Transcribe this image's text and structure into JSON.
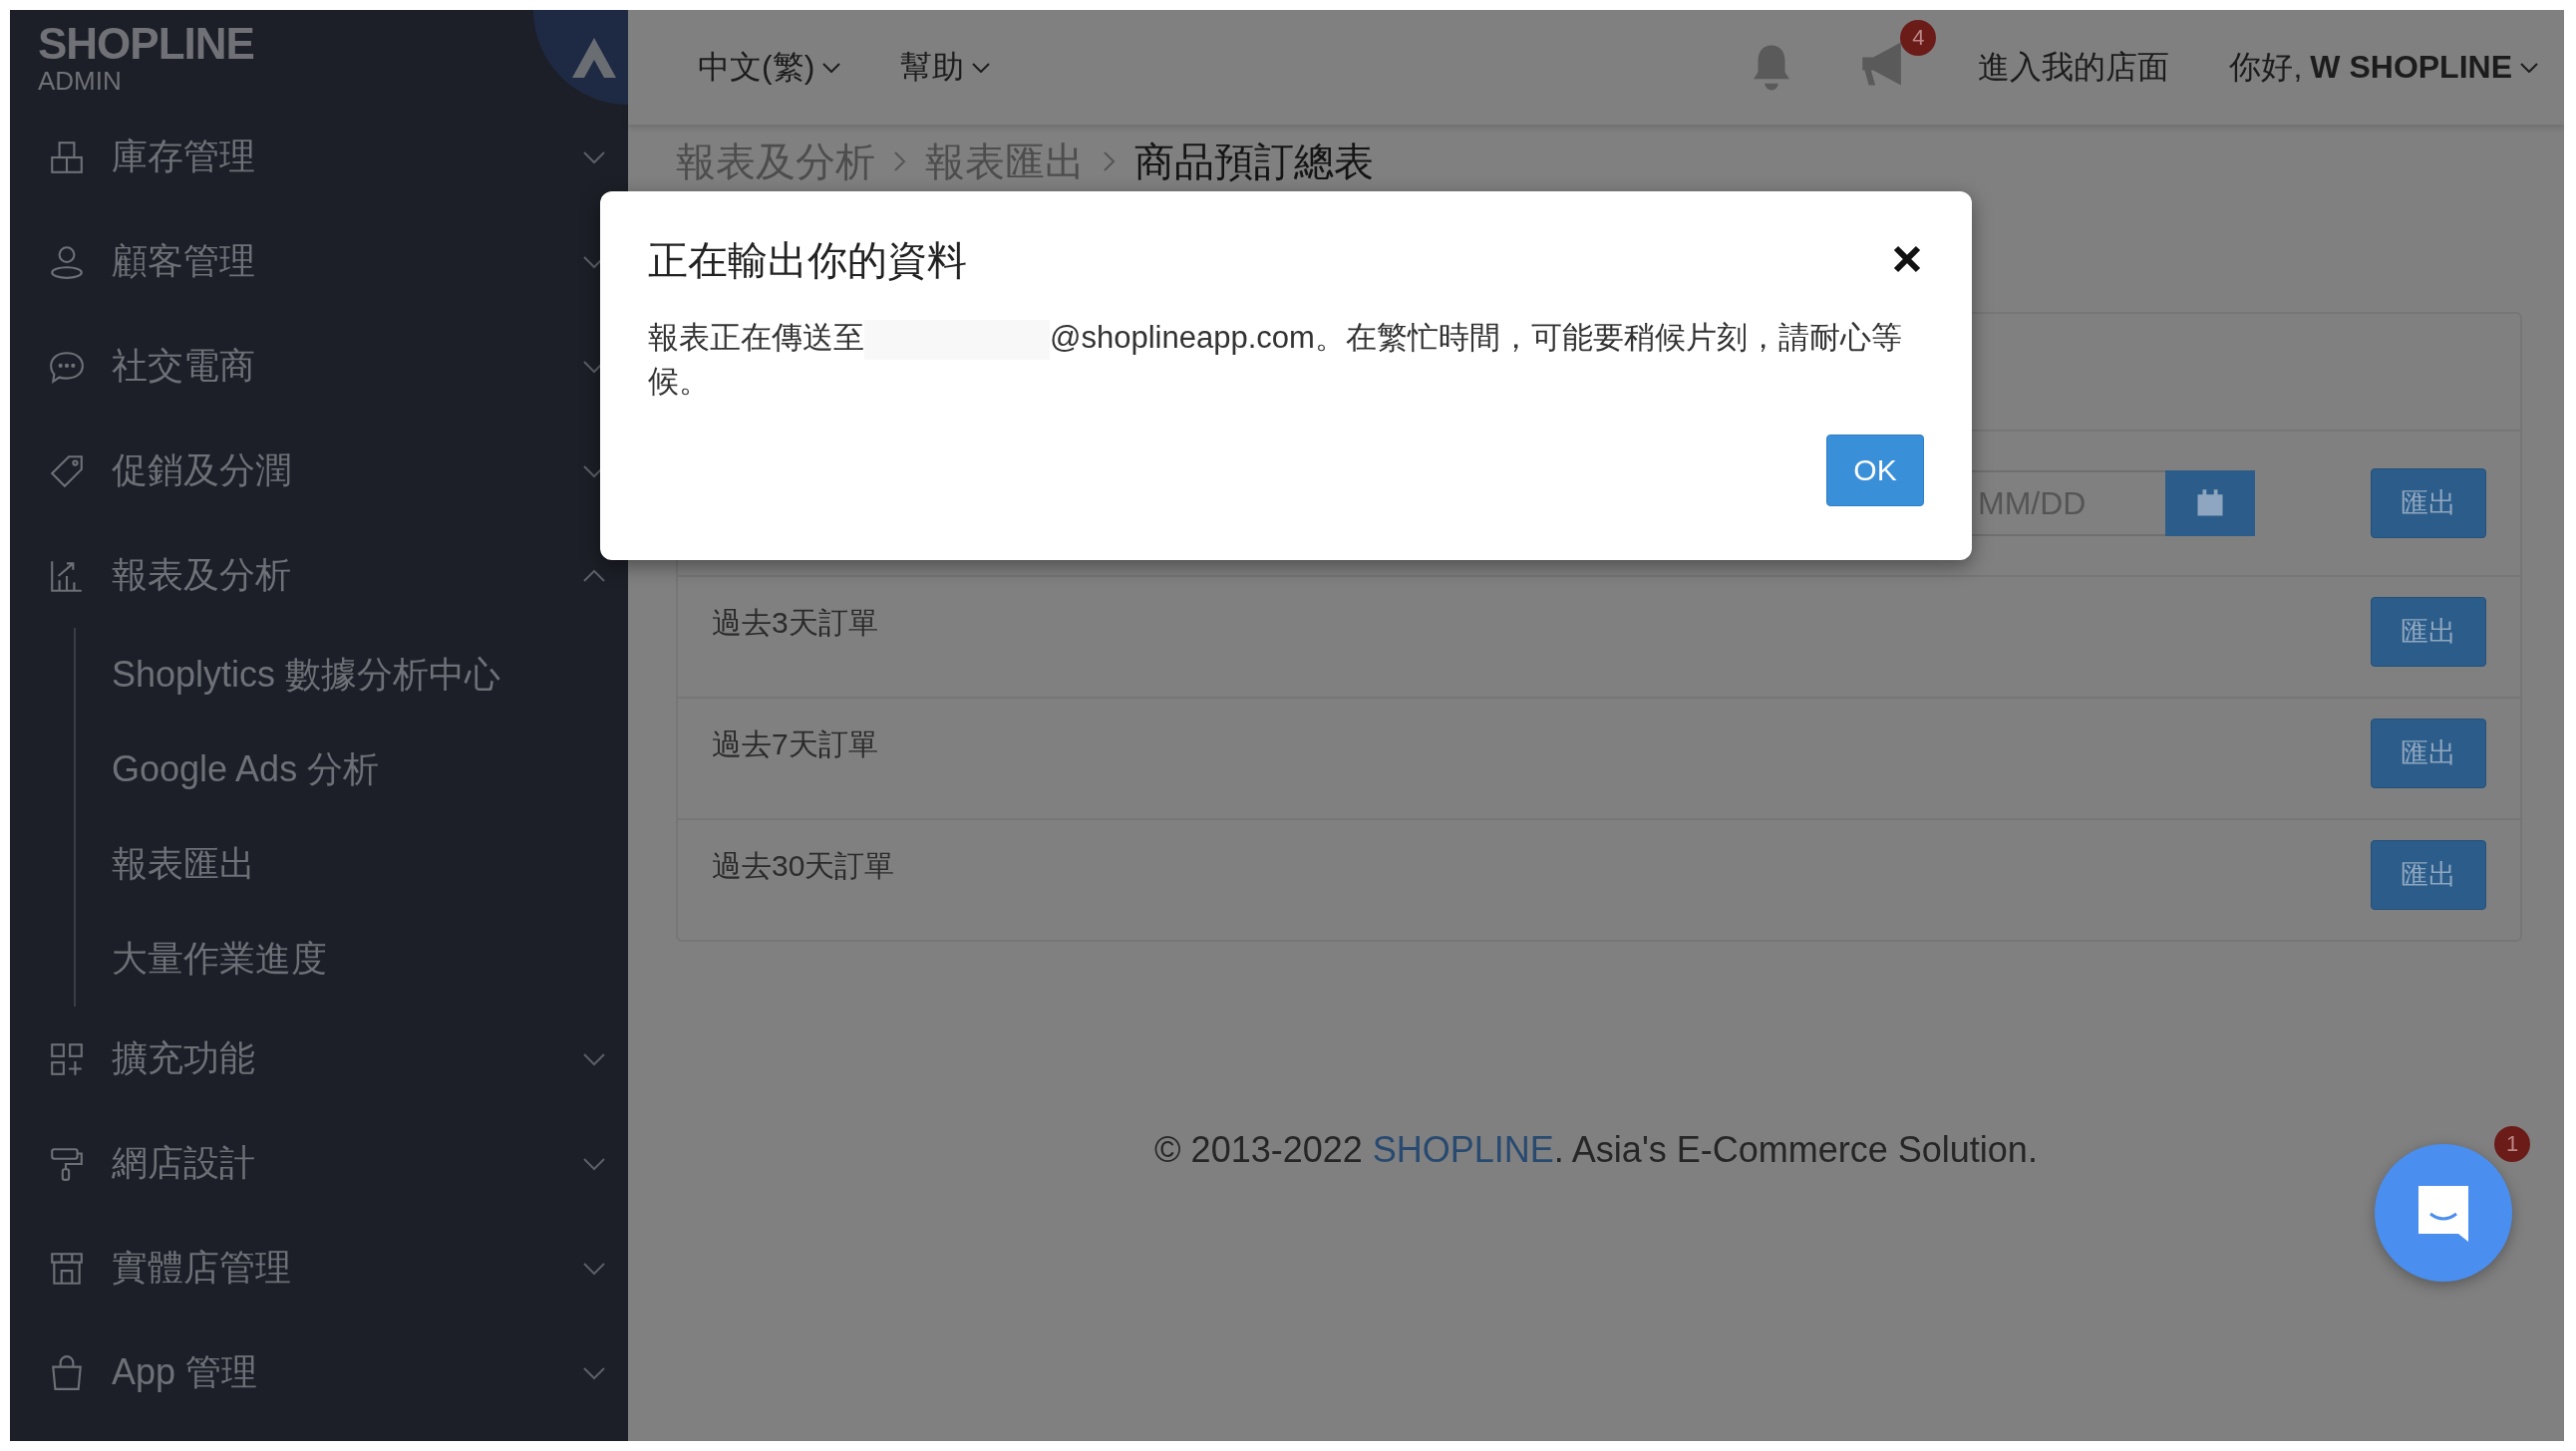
{
  "sidebar": {
    "logo": "SHOPLINE",
    "logo_sub": "ADMIN",
    "items": [
      {
        "label": "庫存管理",
        "expanded": false
      },
      {
        "label": "顧客管理",
        "expanded": false
      },
      {
        "label": "社交電商",
        "expanded": false
      },
      {
        "label": "促銷及分潤",
        "expanded": false
      },
      {
        "label": "報表及分析",
        "expanded": true,
        "children": [
          {
            "label": "Shoplytics 數據分析中心"
          },
          {
            "label": "Google Ads 分析"
          },
          {
            "label": "報表匯出"
          },
          {
            "label": "大量作業進度"
          }
        ]
      },
      {
        "label": "擴充功能",
        "expanded": false
      },
      {
        "label": "網店設計",
        "expanded": false
      },
      {
        "label": "實體店管理",
        "expanded": false
      },
      {
        "label": "App 管理",
        "expanded": false
      }
    ]
  },
  "topbar": {
    "language": "中文(繁)",
    "help": "幫助",
    "announcements_badge": "4",
    "store_link": "進入我的店面",
    "user_menu": "你好, **W SHOPLINE**"
  },
  "breadcrumb": [
    "報表及分析",
    "報表匯出",
    "商品預訂總表"
  ],
  "export_rows": [
    {
      "kind": "date",
      "date_placeholder": "MM/DD",
      "button": "匯出"
    },
    {
      "kind": "preset",
      "label": "過去3天訂單",
      "button": "匯出"
    },
    {
      "kind": "preset",
      "label": "過去7天訂單",
      "button": "匯出"
    },
    {
      "kind": "preset",
      "label": "過去30天訂單",
      "button": "匯出"
    }
  ],
  "footer": {
    "prefix": "© 2013-2022 ",
    "link": "SHOPLINE",
    "suffix": ". Asia's E-Commerce Solution."
  },
  "chat": {
    "badge": "1"
  },
  "dialog": {
    "title": "正在輸出你的資料",
    "message_start": "報表正在傳送至",
    "message_end": "@shoplineapp.com。在繁忙時間，可能要稍候片刻，請耐心等候。",
    "ok": "OK"
  }
}
